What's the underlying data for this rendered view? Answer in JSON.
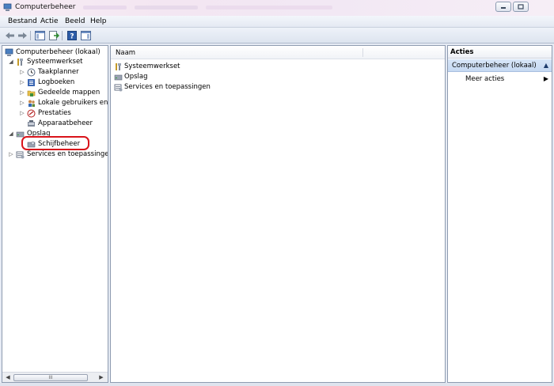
{
  "window": {
    "title": "Computerbeheer",
    "controls": [
      "minimize-icon",
      "maximize-icon"
    ]
  },
  "menu": {
    "items": [
      "Bestand",
      "Actie",
      "Beeld",
      "Help"
    ]
  },
  "toolbar": {
    "icons": [
      "back-arrow-icon",
      "forward-arrow-icon",
      "show-hide-console-tree-icon",
      "export-list-icon",
      "help-icon",
      "show-hide-action-pane-icon"
    ]
  },
  "tree": {
    "root": "Computerbeheer (lokaal)",
    "nodes": [
      {
        "label": "Systeemwerkset"
      },
      {
        "label": "Taakplanner"
      },
      {
        "label": "Logboeken"
      },
      {
        "label": "Gedeelde mappen"
      },
      {
        "label": "Lokale gebruikers en gr"
      },
      {
        "label": "Prestaties"
      },
      {
        "label": "Apparaatbeheer"
      },
      {
        "label": "Opslag"
      },
      {
        "label": "Schijfbeheer"
      },
      {
        "label": "Services en toepassingen"
      }
    ],
    "scroll_thumb": "III"
  },
  "list": {
    "column_header": "Naam",
    "rows": [
      "Systeemwerkset",
      "Opslag",
      "Services en toepassingen"
    ]
  },
  "actions": {
    "header": "Acties",
    "group": "Computerbeheer (lokaal)",
    "item": "Meer acties"
  },
  "colors": {
    "highlight": "#d9141b",
    "action_group_bg": "#c6d9f2",
    "pane_border": "#8e9bb0"
  }
}
